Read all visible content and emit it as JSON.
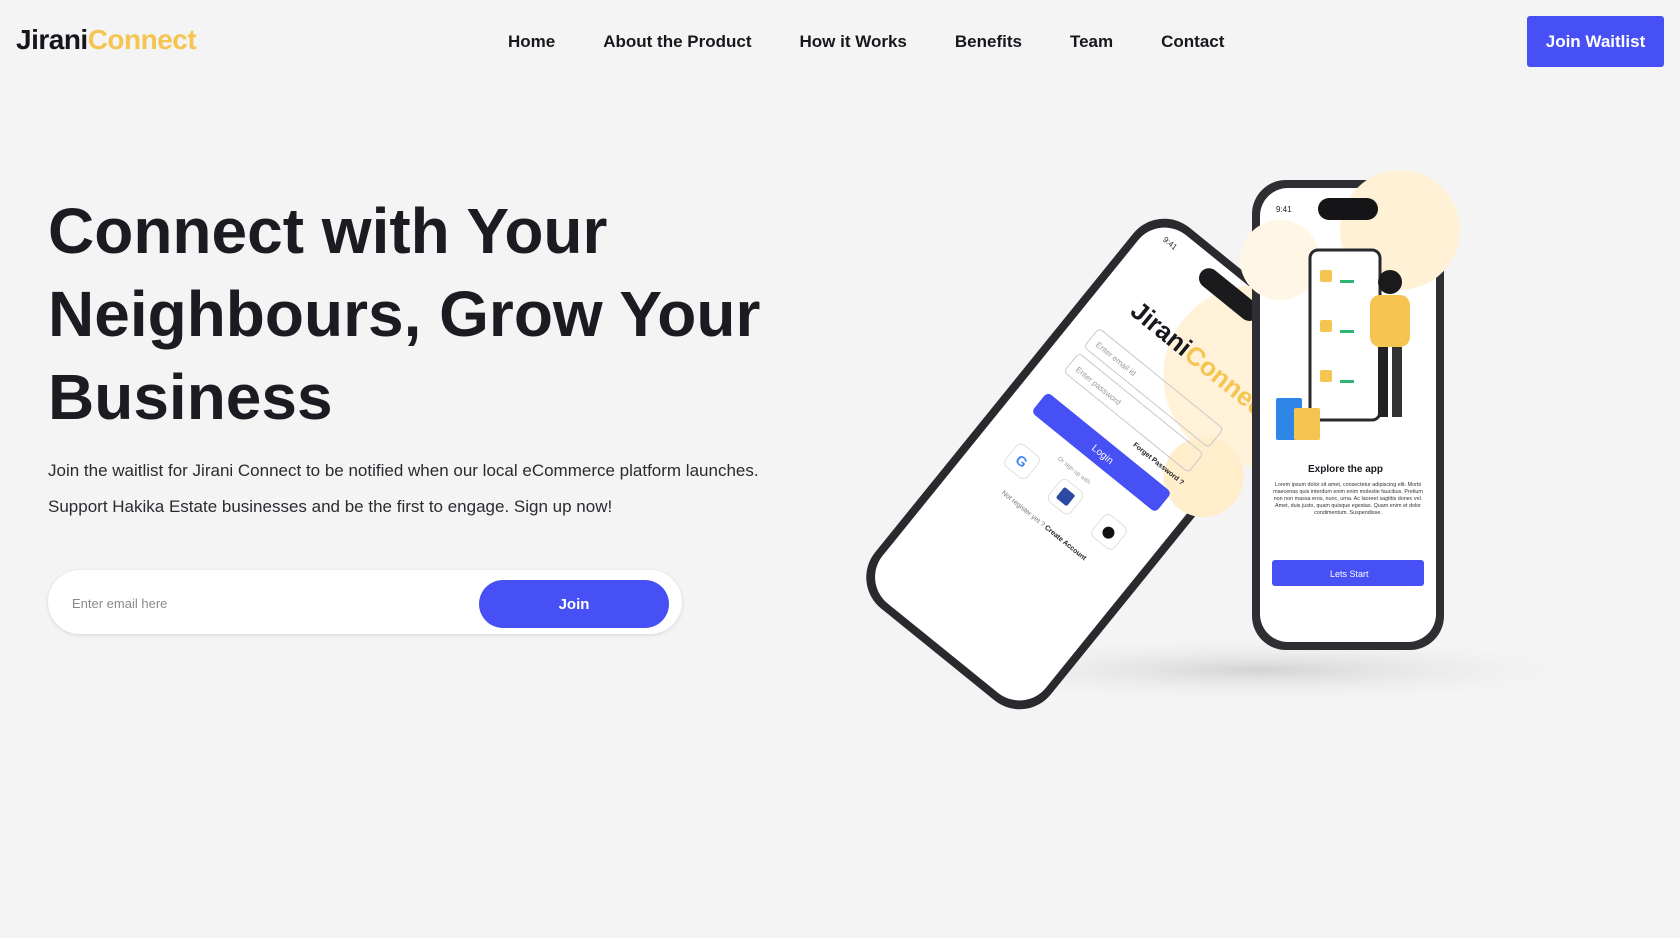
{
  "header": {
    "logo_part1": "Jirani",
    "logo_part2": "Connect",
    "nav": [
      "Home",
      "About the Product",
      "How it Works",
      "Benefits",
      "Team",
      "Contact"
    ],
    "cta_label": "Join Waitlist"
  },
  "hero": {
    "title_line1": "Connect with Your",
    "title_line2": "Neighbours, Grow Your",
    "title_line3": "Business",
    "subtitle_line1": "Join the waitlist for Jirani Connect to be notified when our local eCommerce platform launches.",
    "subtitle_line2": "Support Hakika Estate businesses and be the first to engage. Sign up now!",
    "email_placeholder": "Enter email here",
    "join_label": "Join"
  },
  "phones": {
    "left": {
      "status_time": "9:41",
      "brand_part1": "Jirani",
      "brand_part2": "Connect",
      "email_placeholder": "Enter email id",
      "password_placeholder": "Enter password",
      "forgot": "Forget Password ?",
      "login": "Login",
      "or_signup": "Or sign up with",
      "not_registered": "Not register yet ?",
      "create_account": "Create Account"
    },
    "right": {
      "status_time": "9:41",
      "title": "Explore the app",
      "body": "Lorem ipsum dolor sit amet, consectetur adipiscing elit. Morbi maecenas quis interdum enim enim molestie faucibus. Pretium non non massa eros, nunc, urna. Ac laoreet sagittis donec vel. Amet, duis justo, quam quisque egestas. Quam enim et dolor condimentum. Suspendisse.",
      "cta": "Lets Start"
    }
  },
  "colors": {
    "accent": "#4650f5",
    "brand_yellow": "#f5c451",
    "background": "#f4f4f4"
  }
}
